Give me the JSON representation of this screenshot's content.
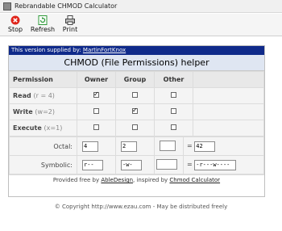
{
  "window": {
    "title": "Rebrandable CHMOD Calculator"
  },
  "toolbar": {
    "stop_label": "Stop",
    "refresh_label": "Refresh",
    "print_label": "Print"
  },
  "supplier": {
    "prefix": "This version supplied by:",
    "link": "MartinFortKnox"
  },
  "heading": "CHMOD (File Permissions) helper",
  "columns": {
    "permission": "Permission",
    "owner": "Owner",
    "group": "Group",
    "other": "Other"
  },
  "rows": [
    {
      "label": "Read",
      "hint": "(r = 4)",
      "owner": true,
      "group": false,
      "other": false
    },
    {
      "label": "Write",
      "hint": "(w=2)",
      "owner": false,
      "group": true,
      "other": false
    },
    {
      "label": "Execute",
      "hint": "(x=1)",
      "owner": false,
      "group": false,
      "other": false
    }
  ],
  "octal": {
    "label": "Octal:",
    "owner": "4",
    "group": "2",
    "other": "",
    "equals": "=",
    "total": "42"
  },
  "symbolic": {
    "label": "Symbolic:",
    "owner": "r--",
    "group": "-w-",
    "other": "",
    "equals": "=",
    "total": "-r---w----"
  },
  "credits": {
    "prefix": "Provided free by",
    "author": "AbleDesign",
    "mid": ", inspired by",
    "inspiration": "Chmod Calculator"
  },
  "footer": "© Copyright http://www.ezau.com - May be distributed freely",
  "colors": {
    "supplier_bar": "#0f2a8a",
    "heading_bg": "#dfe6f2",
    "stop_icon": "#e0251b",
    "refresh_icon": "#2f9a3a"
  }
}
